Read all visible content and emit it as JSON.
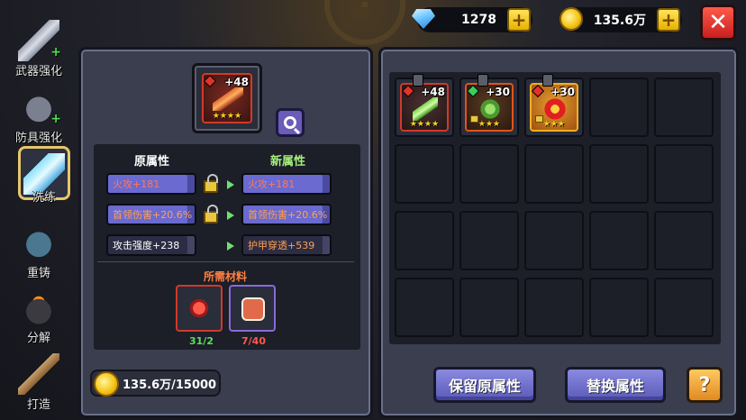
{
  "topbar": {
    "gems": "1278",
    "gold": "135.6万",
    "plus_label": "+",
    "close_label": "✕"
  },
  "sidebar": {
    "items": [
      {
        "label": "武器强化",
        "icon": "sword-icon"
      },
      {
        "label": "防具强化",
        "icon": "armor-icon"
      },
      {
        "label": "洗练",
        "icon": "crystal-sword-icon",
        "active": true
      },
      {
        "label": "重铸",
        "icon": "armor-reforge-icon"
      },
      {
        "label": "分解",
        "icon": "cauldron-icon"
      },
      {
        "label": "打造",
        "icon": "hammer-icon"
      }
    ],
    "plus_mark": "+"
  },
  "item": {
    "level": "+48",
    "stars": "★★★★"
  },
  "attributes": {
    "original_title": "原属性",
    "new_title": "新属性",
    "original": [
      "火攻+181",
      "首领伤害+20.6%",
      "攻击强度+238"
    ],
    "new": [
      "火攻+181",
      "首领伤害+20.6%",
      "护甲穿透+539"
    ]
  },
  "materials": {
    "title": "所需材料",
    "items": [
      {
        "count": "31/2",
        "status_color": "#5ae05a"
      },
      {
        "count": "7/40",
        "status_color": "#ff5a4a"
      }
    ]
  },
  "cost": "135.6万/15000",
  "inventory": {
    "items": [
      {
        "level": "+48",
        "stars": "★★★★"
      },
      {
        "level": "+30",
        "stars": "★★★"
      },
      {
        "level": "+30",
        "stars": "★★★"
      }
    ]
  },
  "buttons": {
    "keep": "保留原属性",
    "swap": "替换属性",
    "help": "?"
  }
}
